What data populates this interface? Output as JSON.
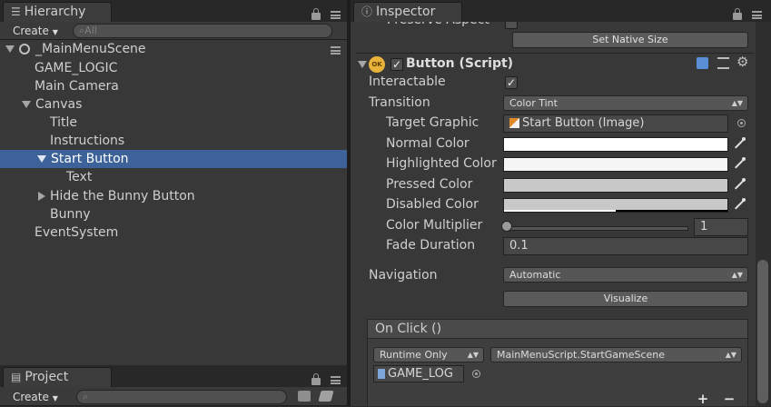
{
  "hierarchy": {
    "tab_label": "Hierarchy",
    "create_label": "Create",
    "search_placeholder": "All",
    "scene_name": "_MainMenuScene",
    "items": [
      {
        "label": "GAME_LOGIC"
      },
      {
        "label": "Main Camera"
      },
      {
        "label": "Canvas"
      },
      {
        "label": "Title"
      },
      {
        "label": "Instructions"
      },
      {
        "label": "Start Button"
      },
      {
        "label": "Text"
      },
      {
        "label": "Hide the Bunny Button"
      },
      {
        "label": "Bunny"
      },
      {
        "label": "EventSystem"
      }
    ]
  },
  "project": {
    "tab_label": "Project",
    "create_label": "Create"
  },
  "inspector": {
    "tab_label": "Inspector",
    "top_partial_label": "Preserve Aspect",
    "set_native_size_label": "Set Native Size",
    "component_title": "Button (Script)",
    "interactable_label": "Interactable",
    "transition_label": "Transition",
    "transition_value": "Color Tint",
    "target_graphic_label": "Target Graphic",
    "target_graphic_value": "Start Button (Image)",
    "normal_color_label": "Normal Color",
    "highlighted_color_label": "Highlighted Color",
    "pressed_color_label": "Pressed Color",
    "disabled_color_label": "Disabled Color",
    "color_multiplier_label": "Color Multiplier",
    "color_multiplier_value": "1",
    "fade_duration_label": "Fade Duration",
    "fade_duration_value": "0.1",
    "navigation_label": "Navigation",
    "navigation_value": "Automatic",
    "visualize_label": "Visualize",
    "onclick_label": "On Click ()",
    "runtime_value": "Runtime Only",
    "function_value": "MainMenuScript.StartGameScene",
    "object_value": "GAME_LOG",
    "plus_label": "+",
    "minus_label": "−",
    "colors": {
      "normal": "#ffffff",
      "highlighted": "#f5f5f5",
      "pressed": "#c8c8c8",
      "disabled": "#c8c8c8"
    }
  },
  "icons": {
    "check": "✓",
    "ok_badge": "OK"
  }
}
